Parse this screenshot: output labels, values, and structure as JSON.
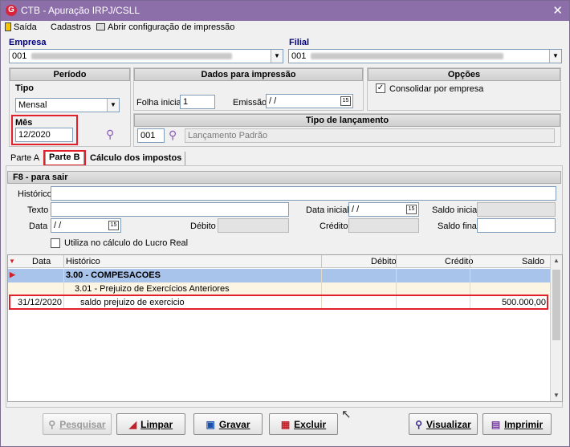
{
  "window": {
    "title": "CTB - Apuração IRPJ/CSLL",
    "close_icon": "close-icon"
  },
  "menu": {
    "exit": "Saída",
    "registers": "Cadastros",
    "print_config": "Abrir configuração de impressão"
  },
  "company": {
    "label": "Empresa",
    "value": "001"
  },
  "branch": {
    "label": "Filial",
    "value": "001"
  },
  "period": {
    "header": "Período",
    "type_label": "Tipo",
    "type_value": "Mensal",
    "month_label": "Mês",
    "month_value": "12/2020"
  },
  "print_data": {
    "header": "Dados para impressão",
    "initial_sheet_label": "Folha inicial",
    "initial_sheet_value": "1",
    "emission_label": "Emissão",
    "emission_value": " / /"
  },
  "options": {
    "header": "Opções",
    "consolidate_label": "Consolidar por empresa",
    "consolidate_checked": "✓"
  },
  "entry_type": {
    "header": "Tipo de lançamento",
    "code": "001",
    "description": "Lançamento Padrão"
  },
  "tabs": [
    {
      "label": "Parte A"
    },
    {
      "label": "Parte B"
    },
    {
      "label": "Cálculo dos impostos"
    }
  ],
  "form": {
    "section": "F8 - para sair",
    "history_label": "Histórico",
    "text_label": "Texto",
    "start_date_label": "Data inicial",
    "start_date_value": " / /",
    "initial_balance_label": "Saldo inicial",
    "date_label": "Data",
    "date_value": " / /",
    "debit_label": "Débito",
    "credit_label": "Crédito",
    "final_balance_label": "Saldo final",
    "real_profit_label": "Utiliza no cálculo do Lucro Real"
  },
  "grid": {
    "columns": [
      "Data",
      "Histórico",
      "Débito",
      "Crédito",
      "Saldo"
    ],
    "rows": [
      {
        "date": "",
        "history": "3.00 - COMPESACOES",
        "debit": "",
        "credit": "",
        "balance": ""
      },
      {
        "date": "",
        "history": "3.01 - Prejuizo de Exercícios Anteriores",
        "debit": "",
        "credit": "",
        "balance": ""
      },
      {
        "date": "31/12/2020",
        "history": "saldo prejuizo de exercicio",
        "debit": "",
        "credit": "",
        "balance": "500.000,00"
      }
    ]
  },
  "buttons": {
    "search": "Pesquisar",
    "clear": "Limpar",
    "save": "Gravar",
    "delete": "Excluir",
    "view": "Visualizar",
    "print": "Imprimir"
  },
  "colors": {
    "titlebar": "#8c6ea8",
    "highlight": "#e0202a",
    "group_row": "#a9c4eb",
    "sub_row": "#fdf5e3"
  }
}
